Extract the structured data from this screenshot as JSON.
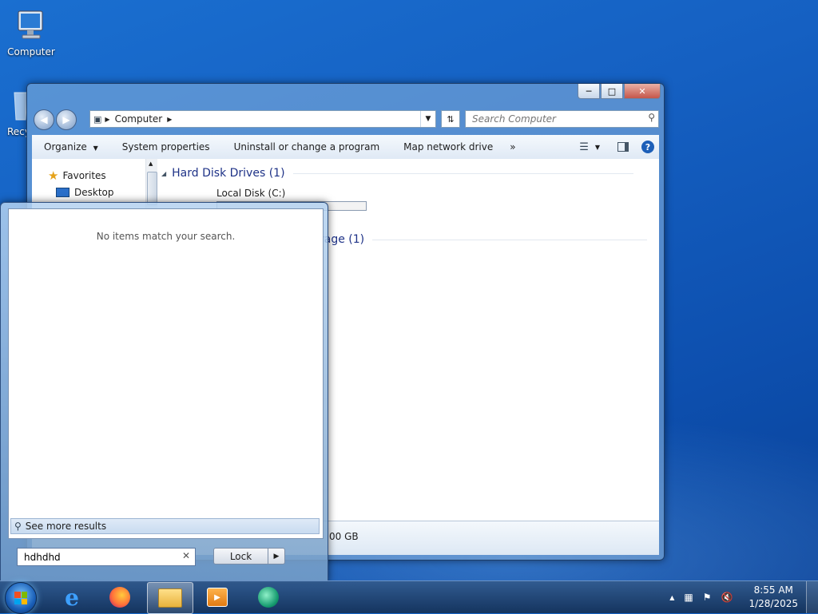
{
  "desktop": {
    "icons": [
      {
        "label": "Computer"
      },
      {
        "label": "Recy"
      }
    ]
  },
  "explorer": {
    "address": {
      "crumb": "Computer"
    },
    "search_placeholder": "Search Computer",
    "toolbar": {
      "organize": "Organize",
      "system_properties": "System properties",
      "uninstall": "Uninstall or change a program",
      "map_drive": "Map network drive",
      "more": "»"
    },
    "nav": {
      "favorites": "Favorites",
      "desktop": "Desktop"
    },
    "groups": {
      "hard_disk": "Hard Disk Drives (1)",
      "local_disk": "Local Disk (C:)",
      "removable_partial": "rage (1)"
    },
    "details": {
      "size_partial": "00 GB"
    }
  },
  "start_menu": {
    "no_items": "No items match your search.",
    "see_more": "See more results",
    "search_value": "hdhdhd",
    "lock_label": "Lock"
  },
  "taskbar": {
    "time": "8:55 AM",
    "date": "1/28/2025"
  },
  "colors": {
    "desktop": "#1560c2",
    "group_header": "#1e3287",
    "taskbar": "#1e3c64"
  }
}
